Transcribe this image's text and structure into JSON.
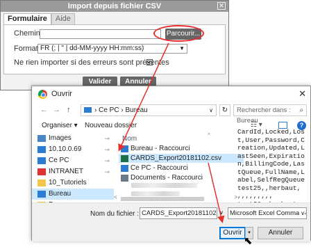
{
  "csv_dialog": {
    "title": "Import depuis fichier CSV",
    "tabs": [
      "Formulaire",
      "Aide"
    ],
    "chemin_label": "Chemin",
    "chemin_value": "",
    "browse_label": "Parcourir...",
    "format_label": "Format",
    "format_value": "FR (; | \" | dd-MM-yyyy HH:mm:ss)",
    "skip_errors_label": "Ne rien importer si des erreurs sont présentes",
    "skip_errors_checked": true,
    "checkbox_glyph": "✔",
    "validate_label": "Valider",
    "cancel_label": "Annuler",
    "close_glyph": "✕"
  },
  "open_dialog": {
    "title": "Ouvrir",
    "close_glyph": "✕",
    "nav": {
      "back": "←",
      "forward": "→",
      "up": "↑"
    },
    "address": [
      "Ce PC",
      "Bureau"
    ],
    "address_sep": "›",
    "search_placeholder": "Rechercher dans : Bureau",
    "organise_label": "Organiser ▾",
    "new_folder_label": "Nouveau dossier",
    "view_icon": "☷ ▾",
    "help_label": "?",
    "sidebar": [
      {
        "label": "Images",
        "icon": "images-icon",
        "color": "#4a86c8",
        "pinned": true
      },
      {
        "label": "10.10.0.69",
        "icon": "network-drive-icon",
        "color": "#2b7cd3",
        "pinned": true
      },
      {
        "label": "Ce PC",
        "icon": "computer-icon",
        "color": "#2b7cd3",
        "pinned": true
      },
      {
        "label": "INTRANET",
        "icon": "intranet-icon",
        "color": "#d33",
        "pinned": true
      },
      {
        "label": "10_Tutoriels",
        "icon": "folder-icon",
        "color": "#f3c54a",
        "pinned": false
      },
      {
        "label": "Bureau",
        "icon": "desktop-icon",
        "color": "#2b7cd3",
        "pinned": false,
        "selected": true
      },
      {
        "label": "Pages_annexes",
        "icon": "folder-icon",
        "color": "#f3c54a",
        "pinned": false
      }
    ],
    "pin_glyph": "📌",
    "column_name": "Nom",
    "files": [
      {
        "label": "Bureau - Raccourci",
        "icon": "shortcut-icon",
        "color": "#2b7cd3"
      },
      {
        "label": "CARDS_Export20181102.csv",
        "icon": "csv-file-icon",
        "color": "#1d7145",
        "selected": true
      },
      {
        "label": "Ce PC - Raccourci",
        "icon": "shortcut-icon",
        "color": "#2b7cd3"
      },
      {
        "label": "Documents - Raccourci",
        "icon": "shortcut-icon",
        "color": "#6a7a8a"
      }
    ],
    "preview_text": "CardId,Locked,Los\nt,User,Password,C\nreation,Updated,L\nastSeen,Expiratio\nn,BillingCode,Las\ntQueue,FullName,L\nabel,SelfRegQueue\ntest25,,herbaut,\n,,,,,,,,,\ntest26,,herbaut,\n,,,,,,,,,",
    "filename_label": "Nom du fichier :",
    "filename_value": "CARDS_Export20181102.csv",
    "filter_value": "Microsoft Excel Comma Separa",
    "open_label": "Ouvrir",
    "cancel_label": "Annuler",
    "caret_glyph": "▾"
  },
  "annotation_color": "#e53030"
}
